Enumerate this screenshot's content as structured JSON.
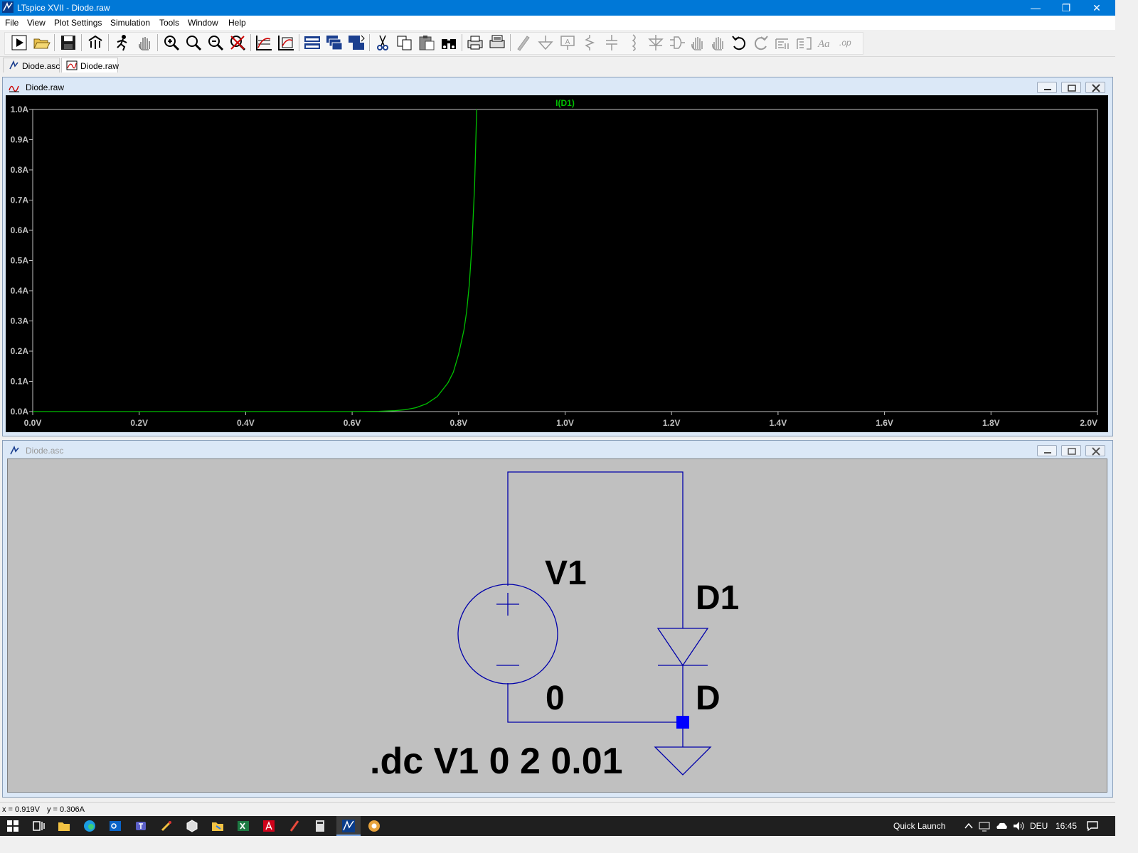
{
  "app": {
    "title": "LTspice XVII - Diode.raw"
  },
  "window_controls": {
    "minimize": "—",
    "restore": "❐",
    "close": "✕"
  },
  "menu": {
    "items": [
      {
        "label": "File"
      },
      {
        "label": "View"
      },
      {
        "label": "Plot Settings"
      },
      {
        "label": "Simulation"
      },
      {
        "label": "Tools"
      },
      {
        "label": "Window"
      },
      {
        "label": "Help"
      }
    ]
  },
  "toolbar": {
    "icons": [
      "run-icon",
      "open-icon",
      "save-icon",
      "control-panel-icon",
      "run-halt-icon",
      "pan-icon",
      "zoom-in-icon",
      "zoom-area-icon",
      "zoom-out-icon",
      "zoom-cancel-icon",
      "autorange-icon",
      "fit-icon",
      "tile-horizontal-icon",
      "cascade-icon",
      "tile-vertical-icon",
      "cut-icon",
      "copy-icon",
      "paste-icon",
      "find-icon",
      "print-icon",
      "print-preview-icon",
      "wire-icon",
      "ground-icon",
      "label-net-icon",
      "resistor-icon",
      "capacitor-icon",
      "inductor-icon",
      "diode-icon",
      "component-icon",
      "move-icon",
      "drag-icon",
      "undo-icon",
      "redo-icon",
      "rotate-icon",
      "mirror-icon",
      "text-icon",
      "spice-directive-icon"
    ]
  },
  "tabs": [
    {
      "label": "Diode.asc"
    },
    {
      "label": "Diode.raw"
    }
  ],
  "plot_window": {
    "title": "Diode.raw"
  },
  "schematic_window": {
    "title": "Diode.asc"
  },
  "chart_data": {
    "type": "line",
    "title": "",
    "series": [
      {
        "name": "I(D1)",
        "color": "#00c000",
        "x": [
          0.0,
          0.6,
          0.65,
          0.68,
          0.7,
          0.72,
          0.74,
          0.76,
          0.78,
          0.79,
          0.8,
          0.81,
          0.815,
          0.82,
          0.825,
          0.83,
          0.834
        ],
        "y": [
          0.0,
          0.0,
          0.001,
          0.003,
          0.006,
          0.013,
          0.026,
          0.05,
          0.095,
          0.13,
          0.19,
          0.27,
          0.33,
          0.42,
          0.55,
          0.75,
          1.0
        ]
      }
    ],
    "x_ticks": [
      "0.0V",
      "0.2V",
      "0.4V",
      "0.6V",
      "0.8V",
      "1.0V",
      "1.2V",
      "1.4V",
      "1.6V",
      "1.8V",
      "2.0V"
    ],
    "y_ticks": [
      "0.0A",
      "0.1A",
      "0.2A",
      "0.3A",
      "0.4A",
      "0.5A",
      "0.6A",
      "0.7A",
      "0.8A",
      "0.9A",
      "1.0A"
    ],
    "xlim": [
      0,
      2
    ],
    "ylim": [
      0,
      1
    ],
    "grid": false,
    "background": "#000000",
    "axis_color": "#c0c0c0"
  },
  "schematic": {
    "source_label": "V1",
    "diode_label": "D1",
    "source_bottom_label": "0",
    "diode_model_label": "D",
    "directive": ".dc V1 0 2 0.01",
    "wire_color": "#0000aa",
    "node_color": "#0000ff"
  },
  "status": {
    "x_readout": "x = 0.919V",
    "y_readout": "y = 0.306A"
  },
  "taskbar": {
    "quick_launch": "Quick Launch",
    "language": "DEU",
    "time": "16:45"
  }
}
